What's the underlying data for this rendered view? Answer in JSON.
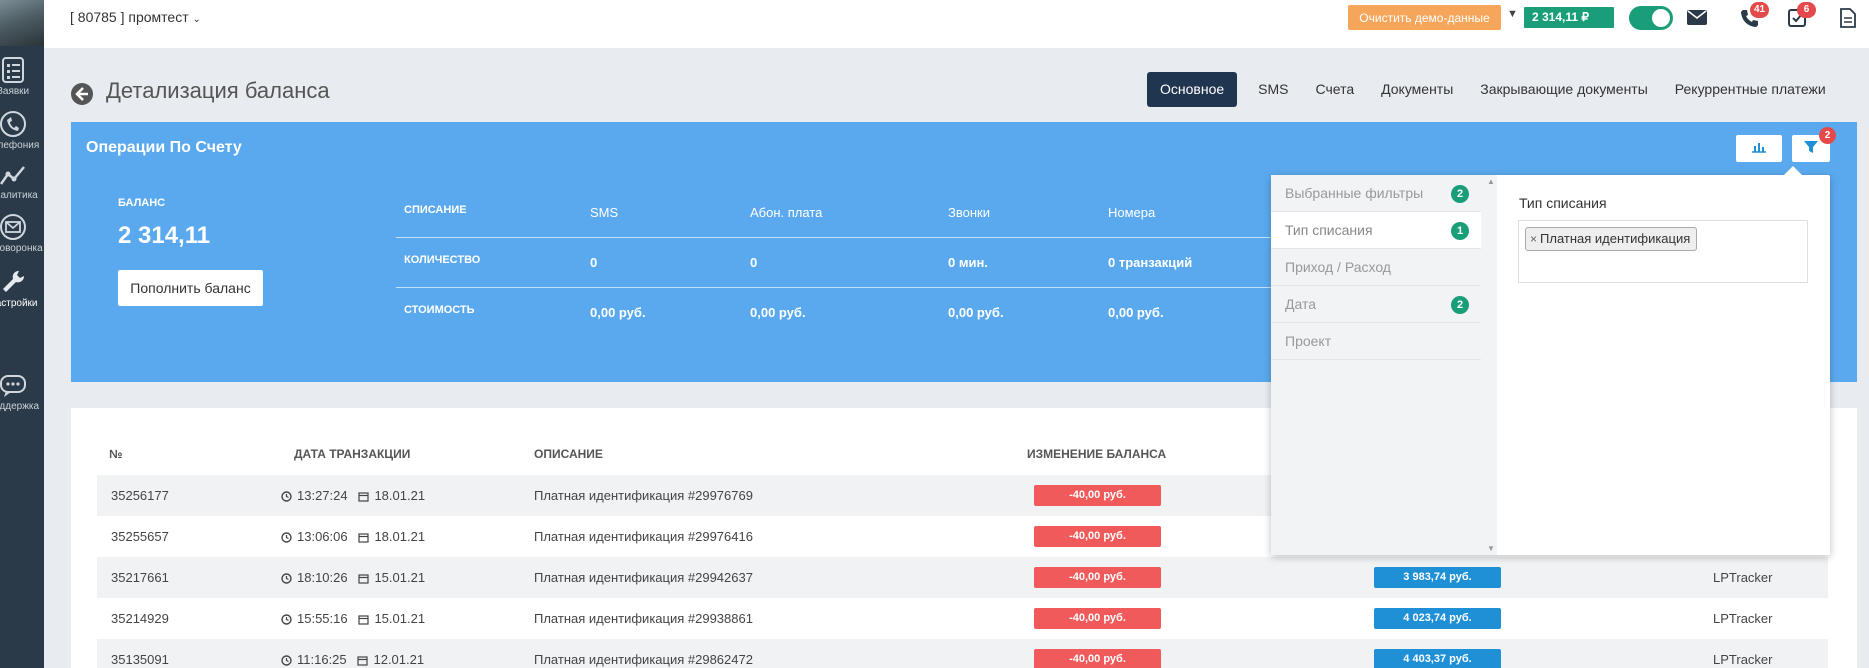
{
  "topbar": {
    "project": "[ 80785 ] промтест",
    "demo_button": "Очистить демо-данные",
    "balance": "2 314,11 ₽",
    "phone_count": "41",
    "tasks_count": "6"
  },
  "sidebar": {
    "items": [
      {
        "label": "Заявки",
        "icon": "list-icon"
      },
      {
        "label": "Телефония",
        "icon": "phone-icon"
      },
      {
        "label": "Аналитика",
        "icon": "analytics-icon"
      },
      {
        "label": "Автоворонка",
        "icon": "mail-icon"
      },
      {
        "label": "Настройки",
        "icon": "wrench-icon"
      },
      {
        "label": "Поддержка",
        "icon": "chat-icon"
      }
    ]
  },
  "page": {
    "title": "Детализация баланса",
    "tabs": [
      "Основное",
      "SMS",
      "Счета",
      "Документы",
      "Закрывающие документы",
      "Рекуррентные платежи"
    ]
  },
  "panel": {
    "title": "Операции По Счету",
    "filter_badge": "2",
    "balance_label": "БАЛАНС",
    "balance_value": "2 314,11",
    "topup_button": "Пополнить баланс",
    "stats": {
      "row_labels": [
        "СПИСАНИЕ",
        "КОЛИЧЕСТВО",
        "СТОИМОСТЬ"
      ],
      "columns": [
        "SMS",
        "Абон. плата",
        "Звонки",
        "Номера"
      ],
      "quantity": [
        "0",
        "0",
        "0 мин.",
        "0 транзакций"
      ],
      "cost": [
        "0,00 руб.",
        "0,00 руб.",
        "0,00 руб.",
        "0,00 руб."
      ]
    }
  },
  "table": {
    "headers": [
      "№",
      "ДАТА ТРАНЗАКЦИИ",
      "ОПИСАНИЕ",
      "ИЗМЕНЕНИЕ БАЛАНСА"
    ],
    "rows": [
      {
        "id": "35256177",
        "time": "13:27:24",
        "date": "18.01.21",
        "desc": "Платная идентификация #29976769",
        "change": "-40,00 руб.",
        "balance": "",
        "source": ""
      },
      {
        "id": "35255657",
        "time": "13:06:06",
        "date": "18.01.21",
        "desc": "Платная идентификация #29976416",
        "change": "-40,00 руб.",
        "balance": "",
        "source": ""
      },
      {
        "id": "35217661",
        "time": "18:10:26",
        "date": "15.01.21",
        "desc": "Платная идентификация #29942637",
        "change": "-40,00 руб.",
        "balance": "3 983,74 руб.",
        "source": "LPTracker"
      },
      {
        "id": "35214929",
        "time": "15:55:16",
        "date": "15.01.21",
        "desc": "Платная идентификация #29938861",
        "change": "-40,00 руб.",
        "balance": "4 023,74 руб.",
        "source": "LPTracker"
      },
      {
        "id": "35135091",
        "time": "11:16:25",
        "date": "12.01.21",
        "desc": "Платная идентификация #29862472",
        "change": "-40,00 руб.",
        "balance": "4 403,37 руб.",
        "source": "LPTracker"
      }
    ]
  },
  "filter": {
    "items": [
      {
        "label": "Выбранные фильтры",
        "count": "2"
      },
      {
        "label": "Тип списания",
        "count": "1"
      },
      {
        "label": "Приход / Расход",
        "count": ""
      },
      {
        "label": "Дата",
        "count": "2"
      },
      {
        "label": "Проект",
        "count": ""
      }
    ],
    "right_title": "Тип списания",
    "chip": "Платная идентификация"
  },
  "chart_data": {
    "type": "table",
    "title": "Операции По Счету",
    "columns": [
      "SMS",
      "Абон. плата",
      "Звонки",
      "Номера"
    ],
    "rows": [
      {
        "name": "КОЛИЧЕСТВО",
        "values": [
          "0",
          "0",
          "0 мин.",
          "0 транзакций"
        ]
      },
      {
        "name": "СТОИМОСТЬ",
        "values": [
          "0,00 руб.",
          "0,00 руб.",
          "0,00 руб.",
          "0,00 руб."
        ]
      }
    ]
  }
}
